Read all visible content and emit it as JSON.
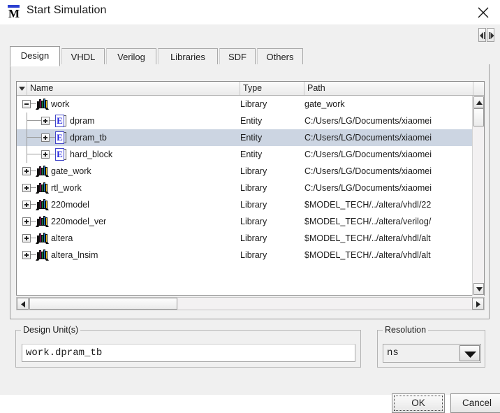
{
  "window": {
    "title": "Start Simulation",
    "app_icon": "modelsim-logo-icon",
    "app_icon_letter": "M",
    "close_label": "✕"
  },
  "tabs": [
    {
      "label": "Design",
      "active": true
    },
    {
      "label": "VHDL",
      "active": false
    },
    {
      "label": "Verilog",
      "active": false
    },
    {
      "label": "Libraries",
      "active": false
    },
    {
      "label": "SDF",
      "active": false
    },
    {
      "label": "Others",
      "active": false
    }
  ],
  "tab_nav": {
    "prev": "tab-scroll-left",
    "next": "tab-scroll-right"
  },
  "tree": {
    "columns": [
      {
        "key": "filter",
        "label": ""
      },
      {
        "key": "name",
        "label": "Name"
      },
      {
        "key": "type",
        "label": "Type"
      },
      {
        "key": "path",
        "label": "Path"
      }
    ],
    "rows": [
      {
        "name": "work",
        "type": "Library",
        "path": "gate_work",
        "icon": "library-icon",
        "depth": 0,
        "expander": "minus",
        "selected": false
      },
      {
        "name": "dpram",
        "type": "Entity",
        "path": "C:/Users/LG/Documents/xiaomei",
        "icon": "entity-icon",
        "depth": 1,
        "expander": "plus",
        "selected": false
      },
      {
        "name": "dpram_tb",
        "type": "Entity",
        "path": "C:/Users/LG/Documents/xiaomei",
        "icon": "entity-icon",
        "depth": 1,
        "expander": "plus",
        "selected": true
      },
      {
        "name": "hard_block",
        "type": "Entity",
        "path": "C:/Users/LG/Documents/xiaomei",
        "icon": "entity-icon",
        "depth": 1,
        "expander": "plus",
        "selected": false
      },
      {
        "name": "gate_work",
        "type": "Library",
        "path": "C:/Users/LG/Documents/xiaomei",
        "icon": "library-icon",
        "depth": 0,
        "expander": "plus",
        "selected": false
      },
      {
        "name": "rtl_work",
        "type": "Library",
        "path": "C:/Users/LG/Documents/xiaomei",
        "icon": "library-icon",
        "depth": 0,
        "expander": "plus",
        "selected": false
      },
      {
        "name": "220model",
        "type": "Library",
        "path": "$MODEL_TECH/../altera/vhdl/22",
        "icon": "library-icon",
        "depth": 0,
        "expander": "plus",
        "selected": false
      },
      {
        "name": "220model_ver",
        "type": "Library",
        "path": "$MODEL_TECH/../altera/verilog/",
        "icon": "library-icon",
        "depth": 0,
        "expander": "plus",
        "selected": false
      },
      {
        "name": "altera",
        "type": "Library",
        "path": "$MODEL_TECH/../altera/vhdl/alt",
        "icon": "library-icon",
        "depth": 0,
        "expander": "plus",
        "selected": false
      },
      {
        "name": "altera_lnsim",
        "type": "Library",
        "path": "$MODEL_TECH/../altera/vhdl/alt",
        "icon": "library-icon",
        "depth": 0,
        "expander": "plus",
        "selected": false
      }
    ]
  },
  "design_units": {
    "legend": "Design Unit(s)",
    "value": "work.dpram_tb"
  },
  "resolution": {
    "legend": "Resolution",
    "value": "ns"
  },
  "buttons": {
    "ok": "OK",
    "cancel": "Cancel"
  },
  "colors": {
    "selection": "#ccd5e2",
    "dialog_bg": "#f0f0f0",
    "list_bg": "#ffffff",
    "entity_blue": "#2626e0",
    "logo_blue": "#2b3fd0"
  }
}
